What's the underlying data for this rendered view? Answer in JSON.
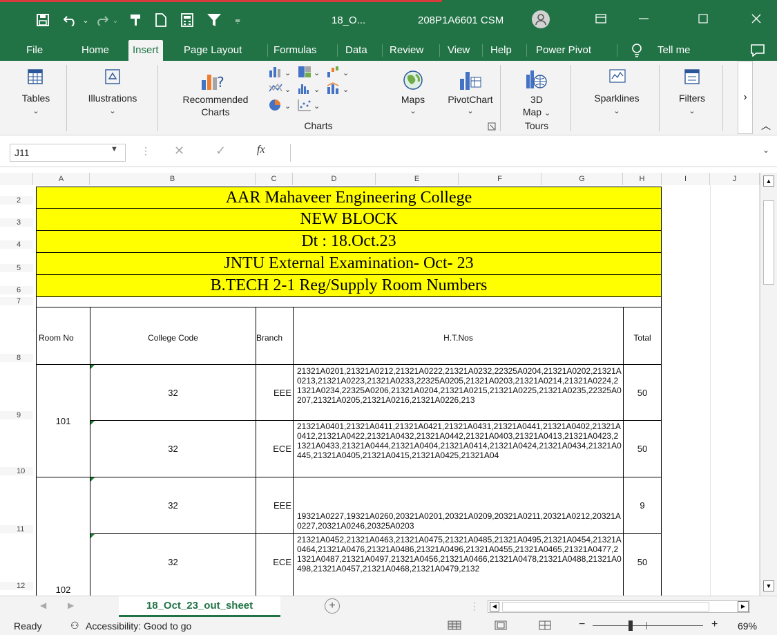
{
  "titlebar": {
    "filename": "18_O...",
    "user": "208P1A6601 CSM"
  },
  "menu": {
    "file": "File",
    "home": "Home",
    "insert": "Insert",
    "page_layout": "Page Layout",
    "formulas": "Formulas",
    "data": "Data",
    "review": "Review",
    "view": "View",
    "help": "Help",
    "power_pivot": "Power Pivot",
    "tell_me": "Tell me"
  },
  "ribbon": {
    "tables": "Tables",
    "illustrations": "Illustrations",
    "recommended_1": "Recommended",
    "recommended_2": "Charts",
    "maps": "Maps",
    "pivotchart": "PivotChart",
    "charts_group": "Charts",
    "map3d_1": "3D",
    "map3d_2": "Map",
    "tours_group": "Tours",
    "sparklines": "Sparklines",
    "filters": "Filters",
    "more": "›"
  },
  "formula_bar": {
    "name_box": "J11",
    "fx": "fx"
  },
  "columns": [
    "A",
    "B",
    "C",
    "D",
    "E",
    "F",
    "G",
    "H",
    "I",
    "J"
  ],
  "rows": [
    "2",
    "3",
    "4",
    "5",
    "6",
    "7",
    "8",
    "9",
    "10",
    "11",
    "12"
  ],
  "banner": {
    "college": "AAR Mahaveer Engineering College",
    "block": "NEW BLOCK",
    "date": "Dt : 18.Oct.23",
    "exam": "JNTU External Examination- Oct- 23",
    "course": "B.TECH 2-1  Reg/Supply Room Numbers"
  },
  "table": {
    "headers": {
      "room_no": "Room No",
      "college_code": "College Code",
      "branch": "Branch",
      "ht_nos": "H.T.Nos",
      "total": "Total"
    },
    "rooms": [
      "101",
      "102"
    ],
    "entries": [
      {
        "college_code": "32",
        "branch": "EEE",
        "total": "50",
        "ht_nos": "21321A0201,21321A0212,21321A0222,21321A0232,22325A0204,21321A0202,21321A0213,21321A0223,21321A0233,22325A0205,21321A0203,21321A0214,21321A0224,21321A0234,22325A0206,21321A0204,21321A0215,21321A0225,21321A0235,22325A0207,21321A0205,21321A0216,21321A0226,213"
      },
      {
        "college_code": "32",
        "branch": "ECE",
        "total": "50",
        "ht_nos": "21321A0401,21321A0411,21321A0421,21321A0431,21321A0441,21321A0402,21321A0412,21321A0422,21321A0432,21321A0442,21321A0403,21321A0413,21321A0423,21321A0433,21321A0444,21321A0404,21321A0414,21321A0424,21321A0434,21321A0445,21321A0405,21321A0415,21321A0425,21321A04"
      },
      {
        "college_code": "32",
        "branch": "EEE",
        "total": "9",
        "ht_nos": "19321A0227,19321A0260,20321A0201,20321A0209,20321A0211,20321A0212,20321A0227,20321A0246,20325A0203"
      },
      {
        "college_code": "32",
        "branch": "ECE",
        "total": "50",
        "ht_nos": "21321A0452,21321A0463,21321A0475,21321A0485,21321A0495,21321A0454,21321A0464,21321A0476,21321A0486,21321A0496,21321A0455,21321A0465,21321A0477,21321A0487,21321A0497,21321A0456,21321A0466,21321A0478,21321A0488,21321A0498,21321A0457,21321A0468,21321A0479,2132"
      }
    ]
  },
  "sheet": {
    "tab_name": "18_Oct_23_out_sheet",
    "add": "+"
  },
  "status": {
    "ready": "Ready",
    "accessibility": "Accessibility: Good to go",
    "zoom": "69%",
    "minus": "−",
    "plus": "+"
  }
}
